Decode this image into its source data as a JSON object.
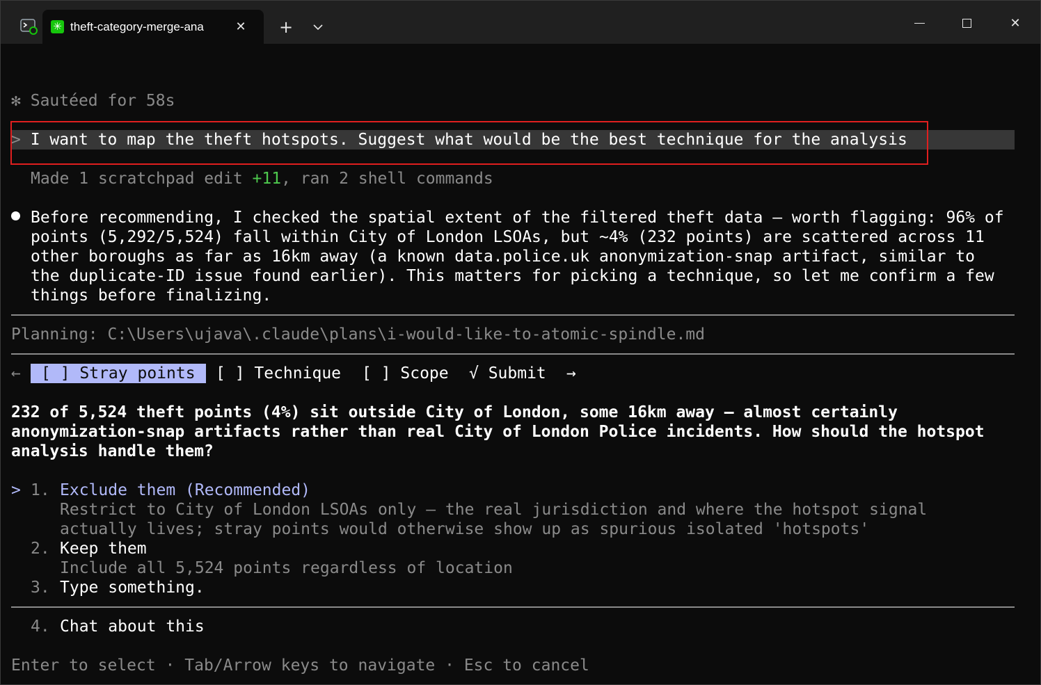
{
  "titlebar": {
    "tab_title": "theft-category-merge-ana",
    "tab_icon": "✳",
    "close_glyph": "✕",
    "new_tab_glyph": "+",
    "dropdown_glyph": "⌵",
    "minimize_label": "minimize",
    "maximize_label": "maximize",
    "close_window_glyph": "✕"
  },
  "status": {
    "spinner": "✻",
    "text": "Sautéed for 58s"
  },
  "prompt": {
    "marker": ">",
    "text": "I want to map the theft hotspots. Suggest what would be the best technique for the analysis"
  },
  "summary": {
    "prefix": "Made ",
    "edits_count": "1",
    "edits_label": " scratchpad edit ",
    "added": "+11",
    "mid": ", ran ",
    "commands_count": "2",
    "commands_label": " shell commands"
  },
  "message": {
    "lines": [
      "Before recommending, I checked the spatial extent of the filtered theft data — worth flagging: 96% of",
      "points (5,292/5,524) fall within City of London LSOAs, but ~4% (232 points) are scattered across 11",
      "other boroughs as far as 16km away (a known data.police.uk anonymization-snap artifact, similar to",
      "the duplicate-ID issue found earlier). This matters for picking a technique, so let me confirm a few",
      "things before finalizing."
    ]
  },
  "planning": {
    "text": "Planning: C:\\Users\\ujava\\.claude\\plans\\i-would-like-to-atomic-spindle.md"
  },
  "question_tabs": {
    "left_arrow": "←",
    "right_arrow": "→",
    "tabs": [
      {
        "label": "[ ] Stray points",
        "active": true
      },
      {
        "label": "[ ] Technique",
        "active": false
      },
      {
        "label": "[ ] Scope",
        "active": false
      },
      {
        "label": "√ Submit",
        "active": false
      }
    ]
  },
  "question": {
    "lines": [
      "232 of 5,524 theft points (4%) sit outside City of London, some 16km away — almost certainly",
      "anonymization-snap artifacts rather than real City of London Police incidents. How should the hotspot",
      "analysis handle them?"
    ]
  },
  "options": [
    {
      "pointer": ">",
      "number": "1.",
      "label": "Exclude them (Recommended)",
      "description": [
        "Restrict to City of London LSOAs only — the real jurisdiction and where the hotspot signal",
        "actually lives; stray points would otherwise show up as spurious isolated 'hotspots'"
      ]
    },
    {
      "number": "2.",
      "label": "Keep them",
      "description": [
        "Include all 5,524 points regardless of location"
      ]
    },
    {
      "number": "3.",
      "label": "Type something."
    },
    {
      "number": "4.",
      "label": "Chat about this"
    }
  ],
  "footer": {
    "hint": "Enter to select · Tab/Arrow keys to navigate · Esc to cancel"
  },
  "colors": {
    "accent": "#b1b9f9",
    "green": "#4ec94e",
    "highlight_box": "#e01f1f",
    "background": "#0c0c0c"
  }
}
